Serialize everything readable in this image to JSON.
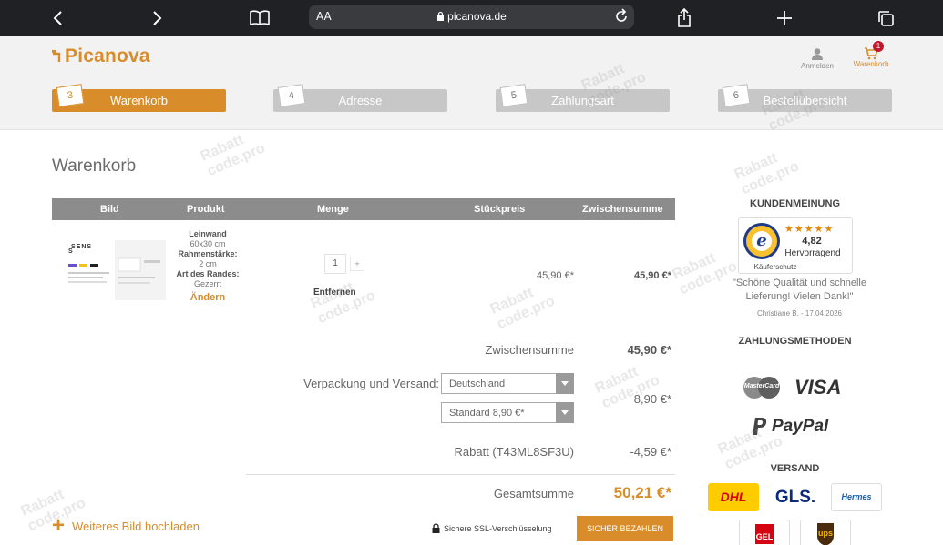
{
  "browser": {
    "aa_label": "AA",
    "url": "picanova.de"
  },
  "header": {
    "logo_text": "Picanova",
    "account_label": "Anmelden",
    "cart_label": "Warenkorb",
    "cart_count": "1"
  },
  "steps": [
    {
      "num": "3",
      "label": "Warenkorb",
      "active": true
    },
    {
      "num": "4",
      "label": "Adresse",
      "active": false
    },
    {
      "num": "5",
      "label": "Zahlungsart",
      "active": false
    },
    {
      "num": "6",
      "label": "Bestellübersicht",
      "active": false
    }
  ],
  "page_title": "Warenkorb",
  "table": {
    "headers": [
      "Bild",
      "Produkt",
      "Menge",
      "Stückpreis",
      "Zwischensumme"
    ]
  },
  "product": {
    "thumb_text": "SENS",
    "line1_label": "Leinwand",
    "line1_value": "60x30 cm",
    "line2_label": "Rahmenstärke:",
    "line2_value": "2 cm",
    "line3_label": "Art des Randes:",
    "line3_value": "Gezerrt",
    "change_label": "Ändern",
    "quantity": "1",
    "plus_label": "+",
    "remove_label": "Entfernen",
    "unit_price": "45,90 €*",
    "subtotal": "45,90 €*"
  },
  "summary": {
    "subtotal_label": "Zwischensumme",
    "subtotal_value": "45,90 €*",
    "shipping_label": "Verpackung und Versand:",
    "country_value": "Deutschland",
    "shipping_method": "Standard 8,90 €*",
    "shipping_value": "8,90 €*",
    "discount_label": "Rabatt (T43ML8SF3U)",
    "discount_value": "-4,59 €*",
    "total_label": "Gesamtsumme",
    "total_value": "50,21 €*"
  },
  "actions": {
    "upload_label": "Weiteres Bild hochladen",
    "ssl_label": "Sichere SSL-Verschlüsselung",
    "pay_label": "SICHER BEZAHLEN"
  },
  "sidebar": {
    "reviews_heading": "KUNDENMEINUNG",
    "ts_stars": "★★★★★",
    "ts_score": "4,82",
    "ts_word": "Hervorragend",
    "ts_footer": "Käuferschutz",
    "quote": "\"Schöne Qualität und schnelle Lieferung! Vielen Dank!\"",
    "reviewer": "Christiane B. - 17.04.2026",
    "payment_heading": "ZAHLUNGSMETHODEN",
    "payment_methods": [
      "MasterCard",
      "VISA",
      "PayPal"
    ],
    "shipping_heading": "VERSAND",
    "carriers": [
      "DHL",
      "GLS.",
      "Hermes",
      "GEL",
      "ups"
    ]
  },
  "watermark": {
    "line1": "Rabatt",
    "line2": "code.pro"
  },
  "colors": {
    "accent": "#d88c2a",
    "step_inactive": "#c7c7c7",
    "table_header": "#8c8c8c",
    "browser_bar": "#202124"
  }
}
